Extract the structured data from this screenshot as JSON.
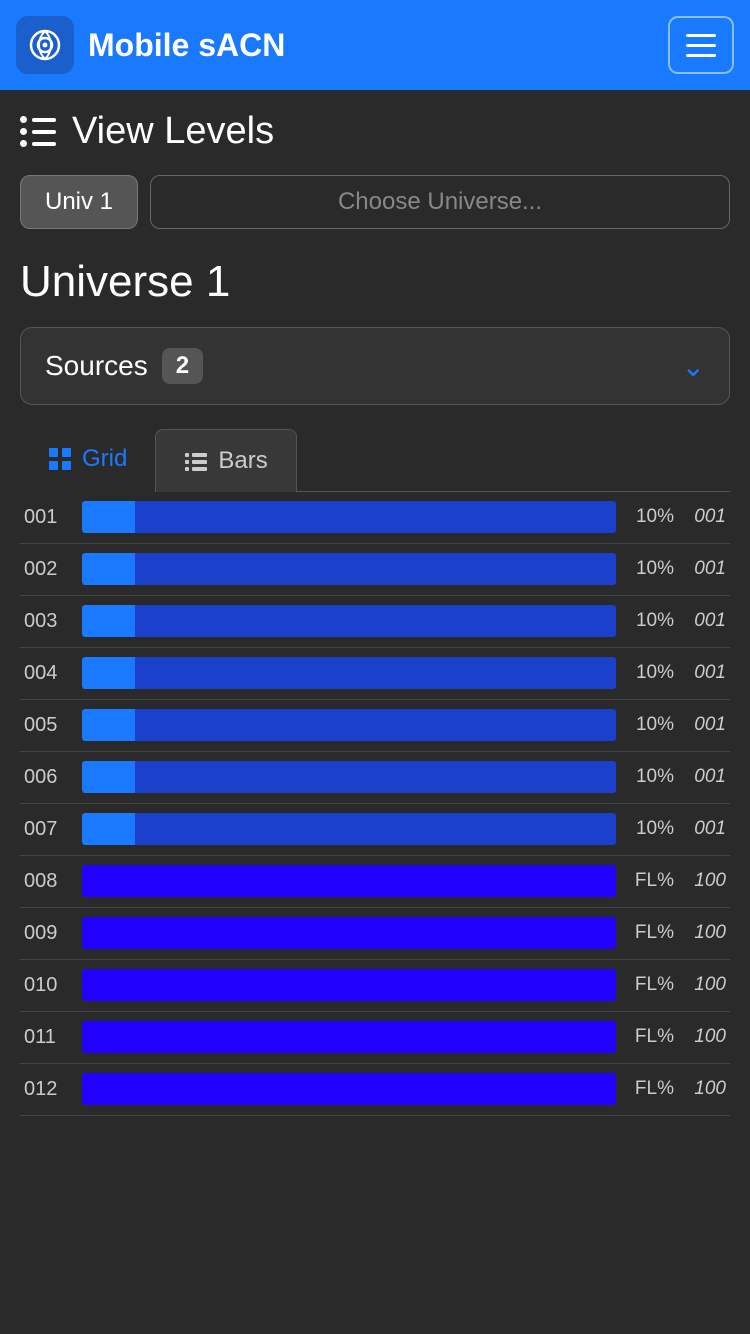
{
  "header": {
    "title": "Mobile sACN",
    "menu_label": "menu"
  },
  "page": {
    "heading": "View Levels",
    "universe_label": "Universe 1"
  },
  "tabs": {
    "univ1": "Univ 1",
    "choose_placeholder": "Choose Universe..."
  },
  "sources": {
    "label": "Sources",
    "count": "2"
  },
  "view_tabs": [
    {
      "id": "grid",
      "label": "Grid",
      "icon": "grid-icon",
      "active": true
    },
    {
      "id": "bars",
      "label": "Bars",
      "icon": "bars-icon",
      "active": false
    }
  ],
  "channels": [
    {
      "num": "001",
      "percent": "10%",
      "source": "001",
      "fill_pct": 10,
      "full": false
    },
    {
      "num": "002",
      "percent": "10%",
      "source": "001",
      "fill_pct": 10,
      "full": false
    },
    {
      "num": "003",
      "percent": "10%",
      "source": "001",
      "fill_pct": 10,
      "full": false
    },
    {
      "num": "004",
      "percent": "10%",
      "source": "001",
      "fill_pct": 10,
      "full": false
    },
    {
      "num": "005",
      "percent": "10%",
      "source": "001",
      "fill_pct": 10,
      "full": false
    },
    {
      "num": "006",
      "percent": "10%",
      "source": "001",
      "fill_pct": 10,
      "full": false
    },
    {
      "num": "007",
      "percent": "10%",
      "source": "001",
      "fill_pct": 10,
      "full": false
    },
    {
      "num": "008",
      "percent": "FL%",
      "source": "100",
      "fill_pct": 100,
      "full": true
    },
    {
      "num": "009",
      "percent": "FL%",
      "source": "100",
      "fill_pct": 100,
      "full": true
    },
    {
      "num": "010",
      "percent": "FL%",
      "source": "100",
      "fill_pct": 100,
      "full": true
    },
    {
      "num": "011",
      "percent": "FL%",
      "source": "100",
      "fill_pct": 100,
      "full": true
    },
    {
      "num": "012",
      "percent": "FL%",
      "source": "100",
      "fill_pct": 100,
      "full": true
    }
  ],
  "colors": {
    "accent": "#1a7aff",
    "bar_bg": "#1a40cc",
    "bar_fill_partial": "#1a7aff",
    "bar_fill_full": "#2200ff"
  }
}
